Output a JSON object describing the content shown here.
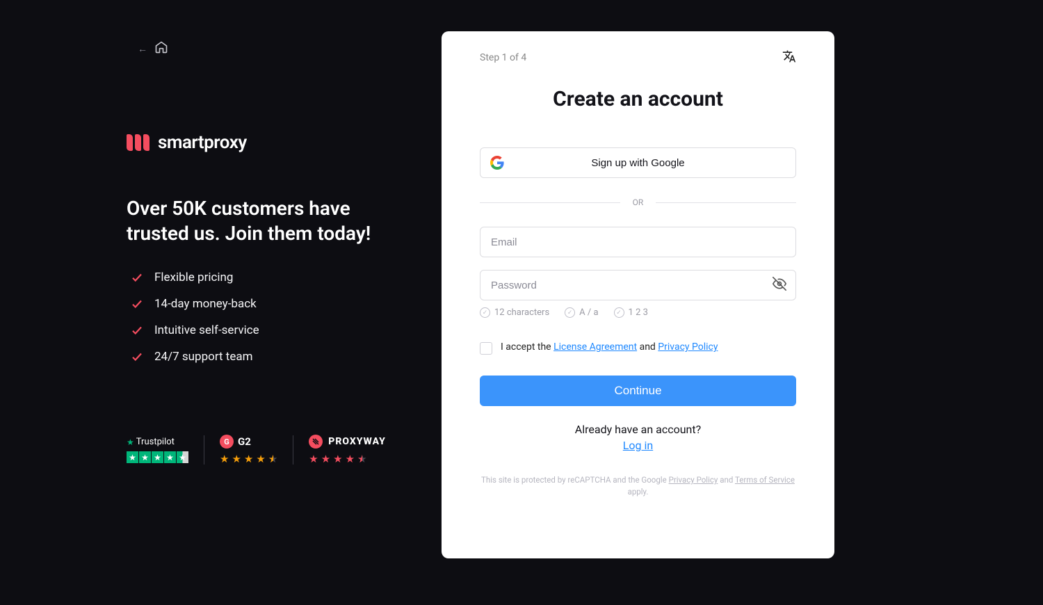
{
  "nav": {
    "back_label": "←"
  },
  "brand": {
    "name": "smartproxy"
  },
  "left": {
    "headline": "Over 50K customers have trusted us. Join them today!",
    "benefits": [
      "Flexible pricing",
      "14-day money-back",
      "Intuitive self-service",
      "24/7 support team"
    ]
  },
  "reviews": {
    "trustpilot": {
      "label": "Trustpilot",
      "rating": 4.5,
      "max": 5
    },
    "g2": {
      "label": "G2",
      "rating": 4.5,
      "max": 5
    },
    "proxyway": {
      "label": "PROXYWAY",
      "rating": 4.5,
      "max": 5
    }
  },
  "form": {
    "step_label": "Step 1 of 4",
    "title": "Create an account",
    "google_button": "Sign up with Google",
    "or": "OR",
    "email_placeholder": "Email",
    "password_placeholder": "Password",
    "password_reqs": [
      "12 characters",
      "A / a",
      "1 2 3"
    ],
    "consent_prefix": "I accept the ",
    "consent_license": "License Agreement",
    "consent_and": " and ",
    "consent_privacy": "Privacy Policy",
    "continue_button": "Continue",
    "login_prompt": "Already have an account?",
    "login_link": "Log in",
    "recaptcha_prefix": "This site is protected by reCAPTCHA and the Google ",
    "recaptcha_privacy": "Privacy Policy",
    "recaptcha_and": " and ",
    "recaptcha_terms": "Terms of Service",
    "recaptcha_suffix": " apply."
  },
  "colors": {
    "accent": "#f44d5f",
    "primary": "#3b94fb",
    "trustpilot": "#00b67a"
  }
}
